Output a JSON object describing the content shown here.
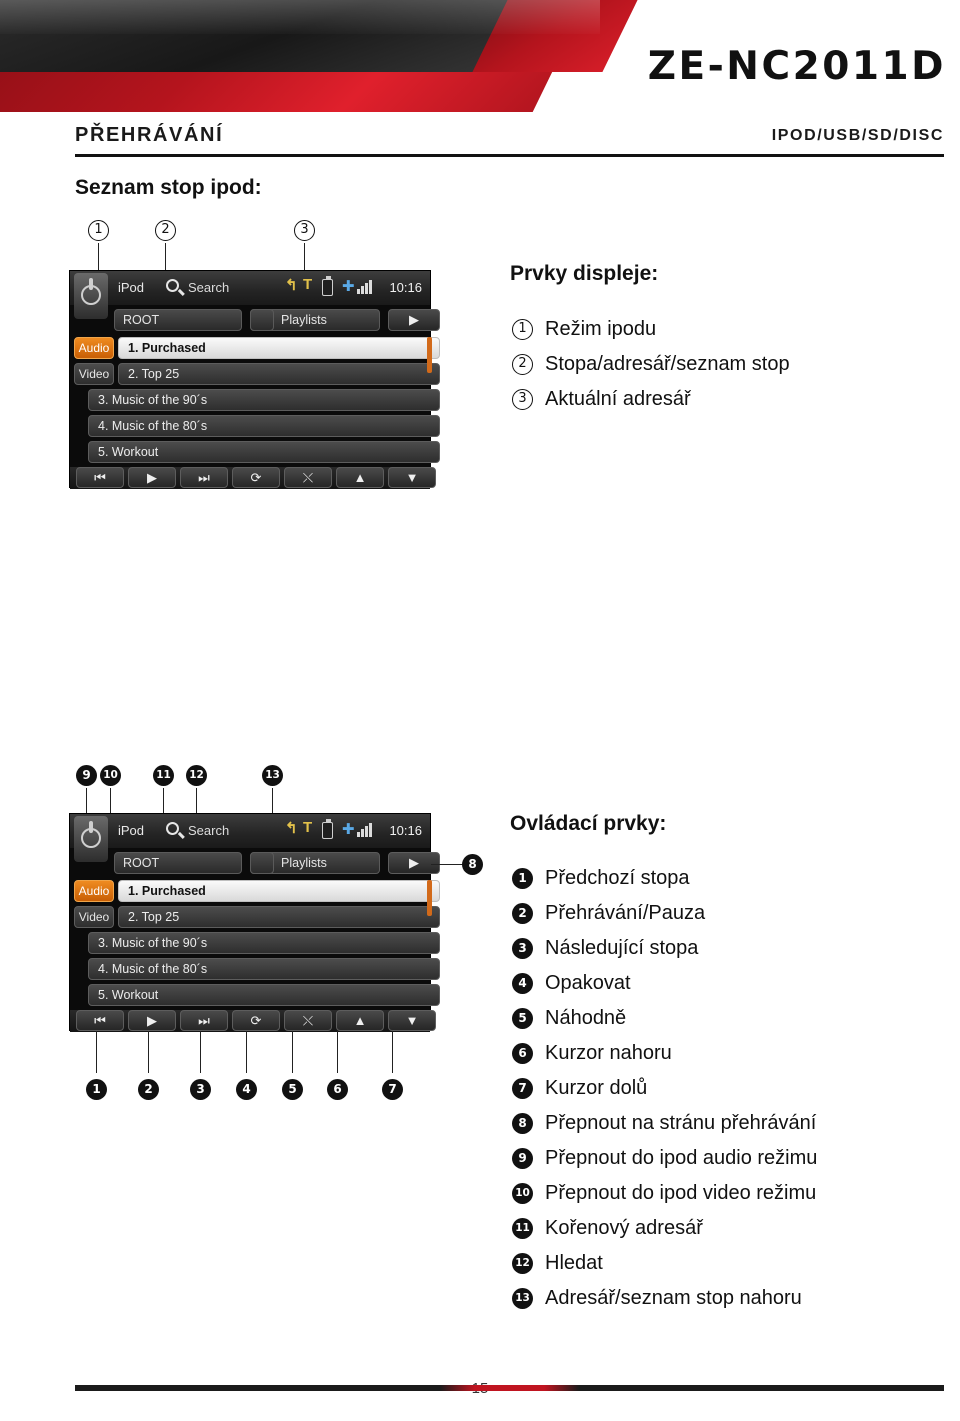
{
  "header": {
    "model": "ZE-NC2011D",
    "section_left": "PŘEHRÁVÁNÍ",
    "section_right": "IPOD/USB/SD/DISC"
  },
  "page": {
    "number": "15"
  },
  "top_block": {
    "title": "Seznam stop ipod:",
    "callouts": [
      "1",
      "2",
      "3"
    ],
    "legend_title": "Prvky displeje:",
    "legend_items": [
      {
        "num": "1",
        "label": "Režim ipodu"
      },
      {
        "num": "2",
        "label": "Stopa/adresář/seznam stop"
      },
      {
        "num": "3",
        "label": "Aktuální adresář"
      }
    ]
  },
  "bottom_block": {
    "callouts_top": [
      "9",
      "10",
      "11",
      "12",
      "13"
    ],
    "callouts_bottom": [
      "1",
      "2",
      "3",
      "4",
      "5",
      "6",
      "7"
    ],
    "callout_right": "8",
    "legend_title": "Ovládací prvky:",
    "legend_items": [
      {
        "num": "1",
        "label": "Předchozí stopa"
      },
      {
        "num": "2",
        "label": "Přehrávání/Pauza"
      },
      {
        "num": "3",
        "label": "Následující stopa"
      },
      {
        "num": "4",
        "label": "Opakovat"
      },
      {
        "num": "5",
        "label": "Náhodně"
      },
      {
        "num": "6",
        "label": "Kurzor nahoru"
      },
      {
        "num": "7",
        "label": "Kurzor dolů"
      },
      {
        "num": "8",
        "label": "Přepnout na stránu přehrávání"
      },
      {
        "num": "9",
        "label": "Přepnout do ipod audio režimu"
      },
      {
        "num": "10",
        "label": "Přepnout do ipod video režimu"
      },
      {
        "num": "11",
        "label": "Kořenový adresář"
      },
      {
        "num": "12",
        "label": "Hledat"
      },
      {
        "num": "13",
        "label": "Adresář/seznam stop nahoru"
      }
    ]
  },
  "device_screen": {
    "source_label": "iPod",
    "search_label": "Search",
    "time": "10:16",
    "root_label": "ROOT",
    "playlists_label": "Playlists",
    "side_buttons": [
      "Audio",
      "Video"
    ],
    "list_items": [
      "1. Purchased",
      "2. Top 25",
      "3. Music of the 90´s",
      "4. Music of the 80´s",
      "5. Workout"
    ],
    "control_icons": [
      "prev-icon",
      "play-icon",
      "next-icon",
      "repeat-icon",
      "shuffle-icon",
      "cursor-up-icon",
      "cursor-down-icon"
    ]
  },
  "colors": {
    "brand_red": "#c01420",
    "accent_orange": "#ef8b21",
    "ink": "#111111"
  }
}
